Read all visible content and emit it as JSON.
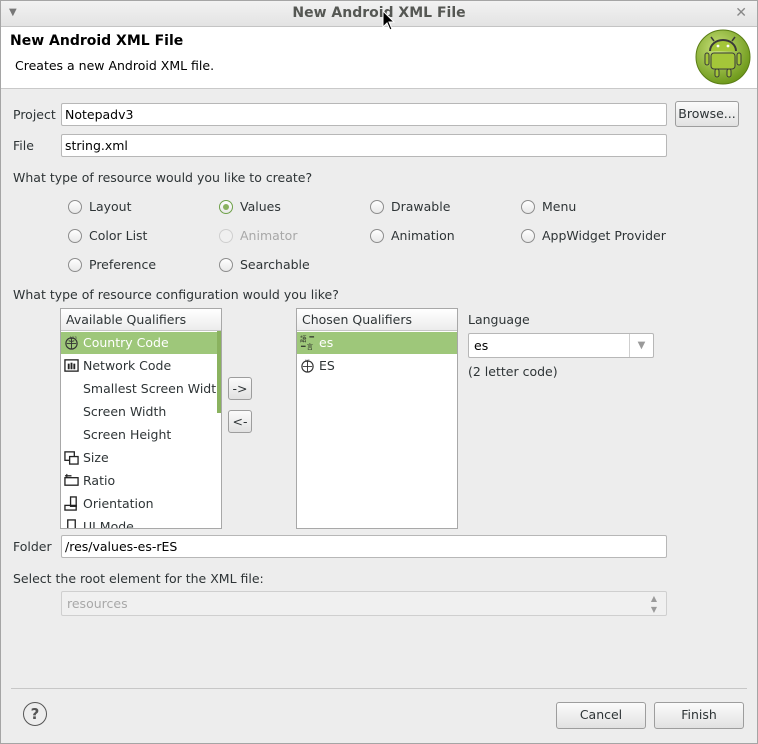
{
  "window": {
    "title": "New Android XML File"
  },
  "header": {
    "title": "New Android XML File",
    "description": "Creates a new Android XML file."
  },
  "project": {
    "label": "Project",
    "value": "Notepadv3",
    "browse_label": "Browse..."
  },
  "file": {
    "label": "File",
    "value": "string.xml"
  },
  "resource_type": {
    "question": "What type of resource would you like to create?",
    "options": [
      {
        "label": "Layout"
      },
      {
        "label": "Values"
      },
      {
        "label": "Drawable"
      },
      {
        "label": "Menu"
      },
      {
        "label": "Color List"
      },
      {
        "label": "Animator"
      },
      {
        "label": "Animation"
      },
      {
        "label": "AppWidget Provider"
      },
      {
        "label": "Preference"
      },
      {
        "label": "Searchable"
      }
    ],
    "selected": "Values",
    "disabled": [
      "Animator"
    ]
  },
  "config": {
    "question": "What type of resource configuration would you like?",
    "available_header": "Available Qualifiers",
    "available": [
      {
        "label": "Country Code",
        "icon": "globe-icon"
      },
      {
        "label": "Network Code",
        "icon": "network-icon"
      },
      {
        "label": "Smallest Screen Width",
        "icon": ""
      },
      {
        "label": "Screen Width",
        "icon": ""
      },
      {
        "label": "Screen Height",
        "icon": ""
      },
      {
        "label": "Size",
        "icon": "size-icon"
      },
      {
        "label": "Ratio",
        "icon": "ratio-icon"
      },
      {
        "label": "Orientation",
        "icon": "orientation-icon"
      },
      {
        "label": "UI Mode",
        "icon": "ui-mode-icon"
      }
    ],
    "selected_available": "Country Code",
    "add_label": "->",
    "remove_label": "<-",
    "chosen_header": "Chosen Qualifiers",
    "chosen": [
      {
        "label": "es",
        "icon": "language-icon"
      },
      {
        "label": "ES",
        "icon": "region-icon"
      }
    ],
    "selected_chosen": "es",
    "language_label": "Language",
    "language_value": "es",
    "language_hint": "(2 letter code)"
  },
  "folder": {
    "label": "Folder",
    "value": "/res/values-es-rES"
  },
  "root_element": {
    "label": "Select the root element for the XML file:",
    "value": "resources"
  },
  "footer": {
    "cancel_label": "Cancel",
    "finish_label": "Finish"
  },
  "colors": {
    "accent": "#9ec77a",
    "android_green": "#a4c639"
  }
}
